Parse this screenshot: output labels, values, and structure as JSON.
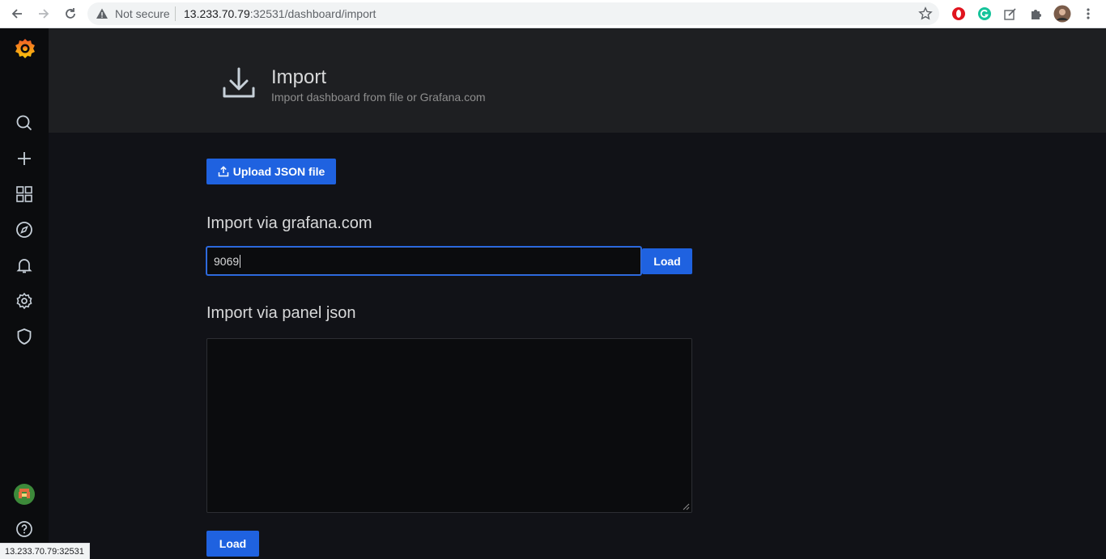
{
  "browser": {
    "security_label": "Not secure",
    "url_host": "13.233.70.79",
    "url_rest": ":32531/dashboard/import",
    "status_url": "13.233.70.79:32531"
  },
  "sidebar": {
    "items": [
      {
        "name": "search",
        "icon": "search-icon"
      },
      {
        "name": "create",
        "icon": "plus-icon"
      },
      {
        "name": "dashboards",
        "icon": "grid-icon"
      },
      {
        "name": "explore",
        "icon": "compass-icon"
      },
      {
        "name": "alerting",
        "icon": "bell-icon"
      },
      {
        "name": "configuration",
        "icon": "gear-icon"
      },
      {
        "name": "server-admin",
        "icon": "shield-icon"
      }
    ]
  },
  "header": {
    "title": "Import",
    "subtitle": "Import dashboard from file or Grafana.com"
  },
  "upload": {
    "label": "Upload JSON file"
  },
  "grafana_com": {
    "title": "Import via grafana.com",
    "value": "9069",
    "load_label": "Load"
  },
  "panel_json": {
    "title": "Import via panel json",
    "value": "",
    "load_label": "Load"
  },
  "colors": {
    "accent": "#1f62e0",
    "background": "#111217",
    "header": "#1e1f22",
    "sidebar": "#0b0c0e"
  }
}
